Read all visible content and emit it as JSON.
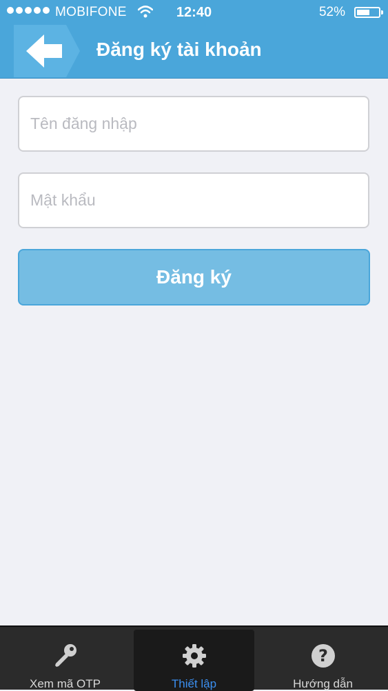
{
  "status_bar": {
    "carrier": "MOBIFONE",
    "time": "12:40",
    "battery_percent": "52%",
    "battery_level": 0.52
  },
  "header": {
    "title": "Đăng ký tài khoản",
    "background_color": "#4aa6da",
    "back_icon": "arrow-left-icon"
  },
  "form": {
    "username_placeholder": "Tên đăng nhập",
    "username_value": "",
    "password_placeholder": "Mật khẩu",
    "password_value": "",
    "submit_label": "Đăng ký",
    "submit_color": "#75bde3"
  },
  "tabbar": {
    "tabs": [
      {
        "label": "Xem mã OTP",
        "icon": "key-icon",
        "active": false
      },
      {
        "label": "Thiết lập",
        "icon": "gear-icon",
        "active": true
      },
      {
        "label": "Hướng dẫn",
        "icon": "question-icon",
        "active": false
      }
    ],
    "active_color": "#3b8ff0"
  }
}
